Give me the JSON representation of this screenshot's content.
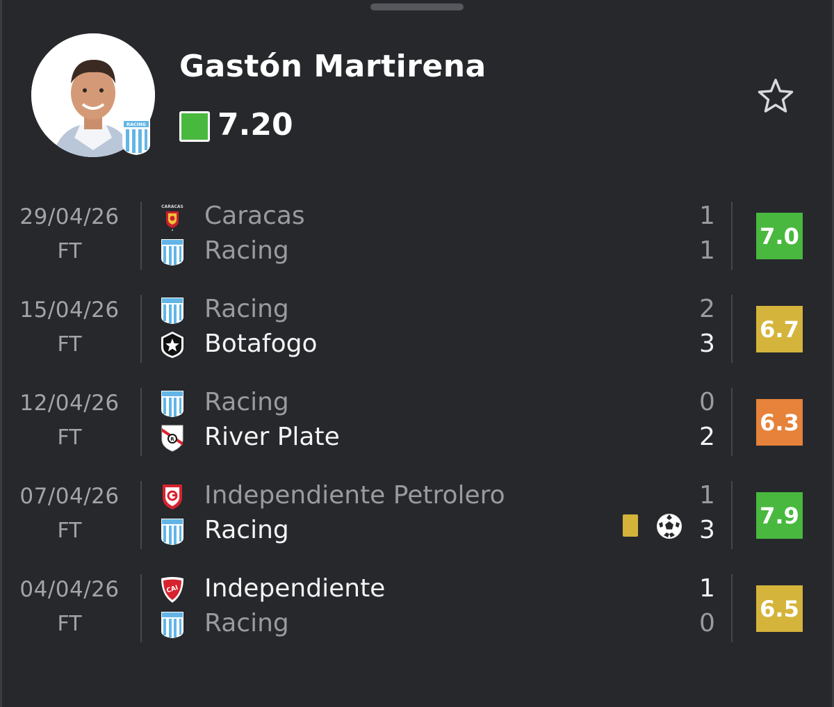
{
  "player": {
    "name": "Gastón Martirena",
    "rating": "7.20",
    "rating_color": "#49b83f",
    "club_badge_text": "RACING"
  },
  "colors": {
    "background": "#26282c",
    "rating_green": "#49b83f",
    "rating_yellow": "#d4b43b",
    "rating_orange": "#e6823a",
    "yellow_card": "#d3b33a"
  },
  "matches": [
    {
      "date": "29/04/26",
      "status": "FT",
      "home": {
        "name": "Caracas",
        "score": "1",
        "logo": "caracas-crest"
      },
      "away": {
        "name": "Racing",
        "score": "1",
        "logo": "racing-crest"
      },
      "rating": "7.0",
      "rating_color": "#49b83f"
    },
    {
      "date": "15/04/26",
      "status": "FT",
      "home": {
        "name": "Racing",
        "score": "2",
        "logo": "racing-crest"
      },
      "away": {
        "name": "Botafogo",
        "score": "3",
        "logo": "botafogo-crest"
      },
      "rating": "6.7",
      "rating_color": "#d4b43b"
    },
    {
      "date": "12/04/26",
      "status": "FT",
      "home": {
        "name": "Racing",
        "score": "0",
        "logo": "racing-crest"
      },
      "away": {
        "name": "River Plate",
        "score": "2",
        "logo": "river-plate-crest"
      },
      "rating": "6.3",
      "rating_color": "#e6823a"
    },
    {
      "date": "07/04/26",
      "status": "FT",
      "home": {
        "name": "Independiente Petrolero",
        "score": "1",
        "logo": "independiente-petrolero-crest"
      },
      "away": {
        "name": "Racing",
        "score": "3",
        "logo": "racing-crest"
      },
      "rating": "7.9",
      "rating_color": "#49b83f",
      "events": [
        "yellow-card-icon",
        "goal-icon"
      ]
    },
    {
      "date": "04/04/26",
      "status": "FT",
      "home": {
        "name": "Independiente",
        "score": "1",
        "logo": "independiente-crest"
      },
      "away": {
        "name": "Racing",
        "score": "0",
        "logo": "racing-crest"
      },
      "rating": "6.5",
      "rating_color": "#d4b43b"
    }
  ]
}
